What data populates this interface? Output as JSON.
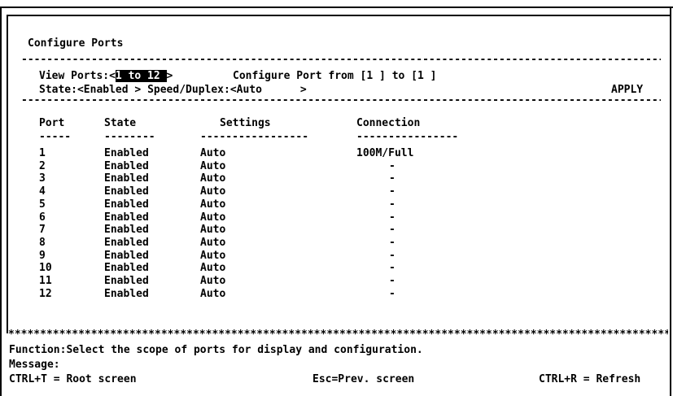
{
  "title": "Configure Ports",
  "view_ports": {
    "label": "View Ports:",
    "value": "1 to 12 "
  },
  "configure_port": {
    "label": "Configure Port from",
    "from": "1",
    "to_label": "to",
    "to": "1"
  },
  "state": {
    "label": "State:",
    "value": "Enabled"
  },
  "speed_duplex": {
    "label": "Speed/Duplex:",
    "value": "Auto"
  },
  "apply_label": "APPLY",
  "table": {
    "columns": [
      "Port",
      "State",
      "Settings",
      "Connection"
    ],
    "rows": [
      {
        "port": "1",
        "state": "Enabled",
        "settings": "Auto",
        "connection": "100M/Full"
      },
      {
        "port": "2",
        "state": "Enabled",
        "settings": "Auto",
        "connection": "-"
      },
      {
        "port": "3",
        "state": "Enabled",
        "settings": "Auto",
        "connection": "-"
      },
      {
        "port": "4",
        "state": "Enabled",
        "settings": "Auto",
        "connection": "-"
      },
      {
        "port": "5",
        "state": "Enabled",
        "settings": "Auto",
        "connection": "-"
      },
      {
        "port": "6",
        "state": "Enabled",
        "settings": "Auto",
        "connection": "-"
      },
      {
        "port": "7",
        "state": "Enabled",
        "settings": "Auto",
        "connection": "-"
      },
      {
        "port": "8",
        "state": "Enabled",
        "settings": "Auto",
        "connection": "-"
      },
      {
        "port": "9",
        "state": "Enabled",
        "settings": "Auto",
        "connection": "-"
      },
      {
        "port": "10",
        "state": "Enabled",
        "settings": "Auto",
        "connection": "-"
      },
      {
        "port": "11",
        "state": "Enabled",
        "settings": "Auto",
        "connection": "-"
      },
      {
        "port": "12",
        "state": "Enabled",
        "settings": "Auto",
        "connection": "-"
      }
    ]
  },
  "function_text": "Function:Select the scope of ports for display and configuration.",
  "message_label": "Message:",
  "footer": {
    "root": "CTRL+T = Root screen",
    "prev": "Esc=Prev. screen",
    "refresh": "CTRL+R = Refresh"
  }
}
